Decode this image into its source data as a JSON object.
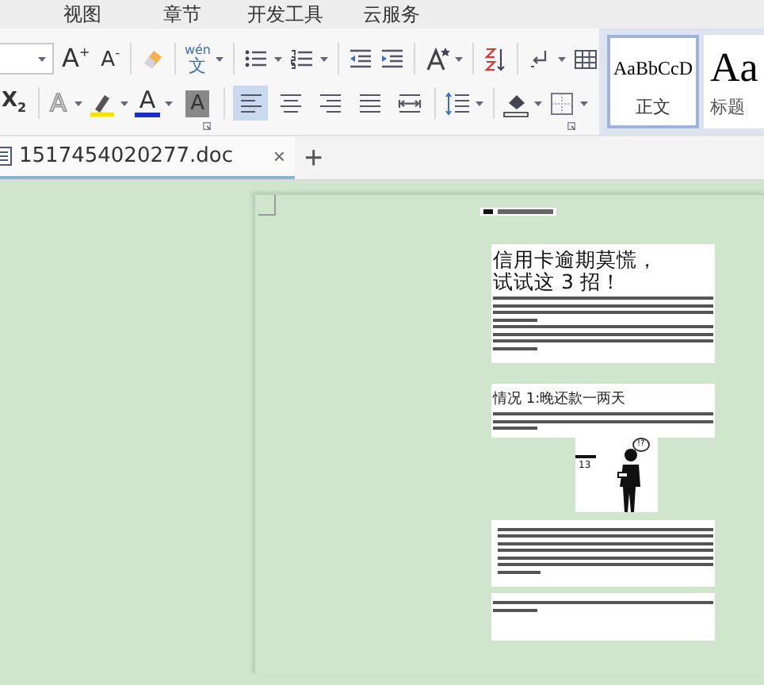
{
  "menu": [
    {
      "label": "视图"
    },
    {
      "label": "章节"
    },
    {
      "label": "开发工具"
    },
    {
      "label": "云服务"
    }
  ],
  "toolbar": {
    "text_buttons": [
      "A$^{+}$",
      "A$^{-}$",
      "wén",
      "文",
      "X$_{2}$",
      "A",
      "A",
      "A"
    ],
    "alignments": [
      {
        "selected": true
      },
      {
        "selected": false
      },
      {
        "selected": false
      },
      {
        "selected": false
      },
      {
        "selected": false
      }
    ]
  },
  "styles": [
    {
      "sample": "AaBbCcD",
      "label": "正文",
      "selected": true
    },
    {
      "sample": "Aa",
      "label": "标题",
      "selected": false
    }
  ],
  "tabs": [
    {
      "title": "1517454020277.doc",
      "close": "×",
      "selected": true
    }
  ],
  "new_tab": "+",
  "document": {
    "title_lines": [
      "信用卡逾期莫慌，",
      "试试这 3 招！"
    ],
    "section_heading": "情况 1:晚还款一两天",
    "figure_labels": [
      "13",
      "!?"
    ]
  }
}
